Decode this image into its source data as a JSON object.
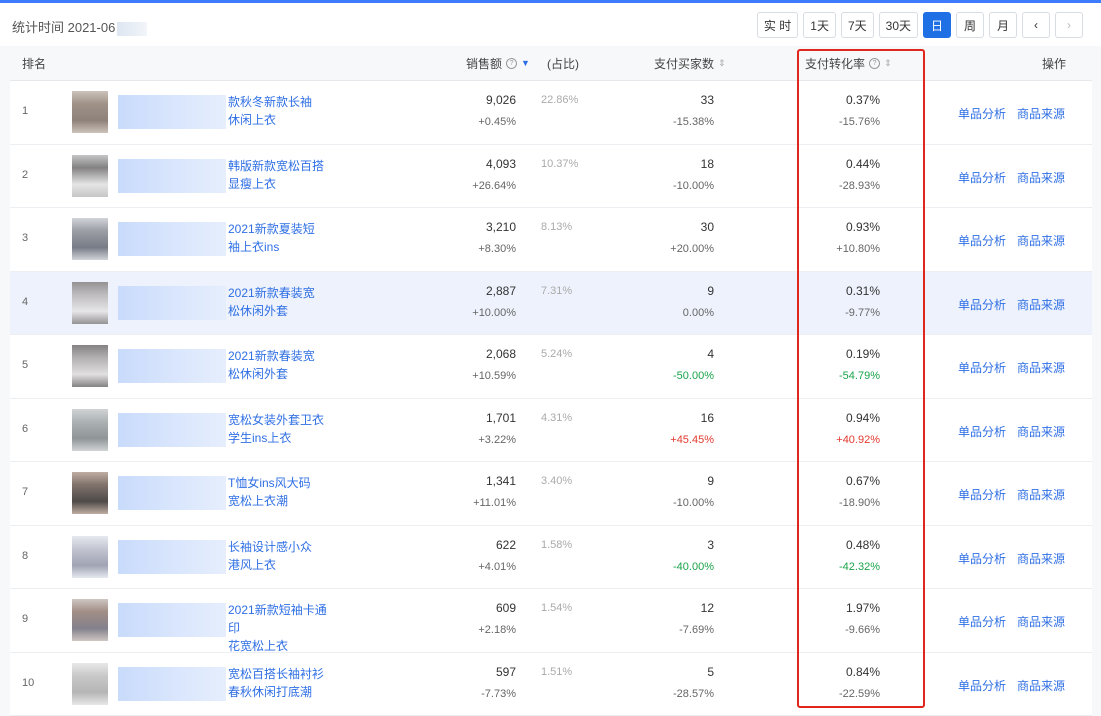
{
  "header": {
    "stat_time": "统计时间 2021-06",
    "ranges": [
      "实 时",
      "1天",
      "7天",
      "30天",
      "日",
      "周",
      "月"
    ],
    "active_range": "日",
    "prev_label": "‹",
    "next_label": "›"
  },
  "columns": {
    "rank": "排名",
    "sales": "销售额",
    "share": "(占比)",
    "buyers": "支付买家数",
    "conversion": "支付转化率",
    "action": "操作"
  },
  "actions": {
    "analysis": "单品分析",
    "source": "商品来源"
  },
  "colors": {
    "accent": "#1f6fe5",
    "link": "#2f6fe4",
    "up": "#e23a2f",
    "down": "#1aa34a",
    "highlight_border": "#e0261d"
  },
  "rows": [
    {
      "rank": "1",
      "title1": "款秋冬新款长袖",
      "title2": "休闲上衣",
      "sales": "9,026",
      "sales_change": "+0.45%",
      "share": "22.86%",
      "buyers": "33",
      "buyers_change": "-15.38%",
      "conv": "0.37%",
      "conv_change": "-15.76%"
    },
    {
      "rank": "2",
      "title1": "韩版新款宽松百搭",
      "title2": "显瘦上衣",
      "sales": "4,093",
      "sales_change": "+26.64%",
      "share": "10.37%",
      "buyers": "18",
      "buyers_change": "-10.00%",
      "conv": "0.44%",
      "conv_change": "-28.93%"
    },
    {
      "rank": "3",
      "title1": "2021新款夏装短",
      "title2": "袖上衣ins",
      "sales": "3,210",
      "sales_change": "+8.30%",
      "share": "8.13%",
      "buyers": "30",
      "buyers_change": "+20.00%",
      "conv": "0.93%",
      "conv_change": "+10.80%"
    },
    {
      "rank": "4",
      "title1": "2021新款春装宽",
      "title2": "松休闲外套",
      "sales": "2,887",
      "sales_change": "+10.00%",
      "share": "7.31%",
      "buyers": "9",
      "buyers_change": "0.00%",
      "conv": "0.31%",
      "conv_change": "-9.77%"
    },
    {
      "rank": "5",
      "title1": "2021新款春装宽",
      "title2": "松休闲外套",
      "sales": "2,068",
      "sales_change": "+10.59%",
      "share": "5.24%",
      "buyers": "4",
      "buyers_change": "-50.00%",
      "conv": "0.19%",
      "conv_change": "-54.79%"
    },
    {
      "rank": "6",
      "title1": "宽松女装外套卫衣",
      "title2": "学生ins上衣",
      "sales": "1,701",
      "sales_change": "+3.22%",
      "share": "4.31%",
      "buyers": "16",
      "buyers_change": "+45.45%",
      "conv": "0.94%",
      "conv_change": "+40.92%"
    },
    {
      "rank": "7",
      "title1": "T恤女ins风大码",
      "title2": "宽松上衣潮",
      "sales": "1,341",
      "sales_change": "+11.01%",
      "share": "3.40%",
      "buyers": "9",
      "buyers_change": "-10.00%",
      "conv": "0.67%",
      "conv_change": "-18.90%"
    },
    {
      "rank": "8",
      "title1": "长袖设计感小众",
      "title2": "港风上衣",
      "sales": "622",
      "sales_change": "+4.01%",
      "share": "1.58%",
      "buyers": "3",
      "buyers_change": "-40.00%",
      "conv": "0.48%",
      "conv_change": "-42.32%"
    },
    {
      "rank": "9",
      "title1": "2021新款短袖卡通印",
      "title2": "花宽松上衣",
      "sales": "609",
      "sales_change": "+2.18%",
      "share": "1.54%",
      "buyers": "12",
      "buyers_change": "-7.69%",
      "conv": "1.97%",
      "conv_change": "-9.66%"
    },
    {
      "rank": "10",
      "title1": "宽松百搭长袖衬衫",
      "title2": "春秋休闲打底潮",
      "sales": "597",
      "sales_change": "-7.73%",
      "share": "1.51%",
      "buyers": "5",
      "buyers_change": "-28.57%",
      "conv": "0.84%",
      "conv_change": "-22.59%"
    }
  ]
}
